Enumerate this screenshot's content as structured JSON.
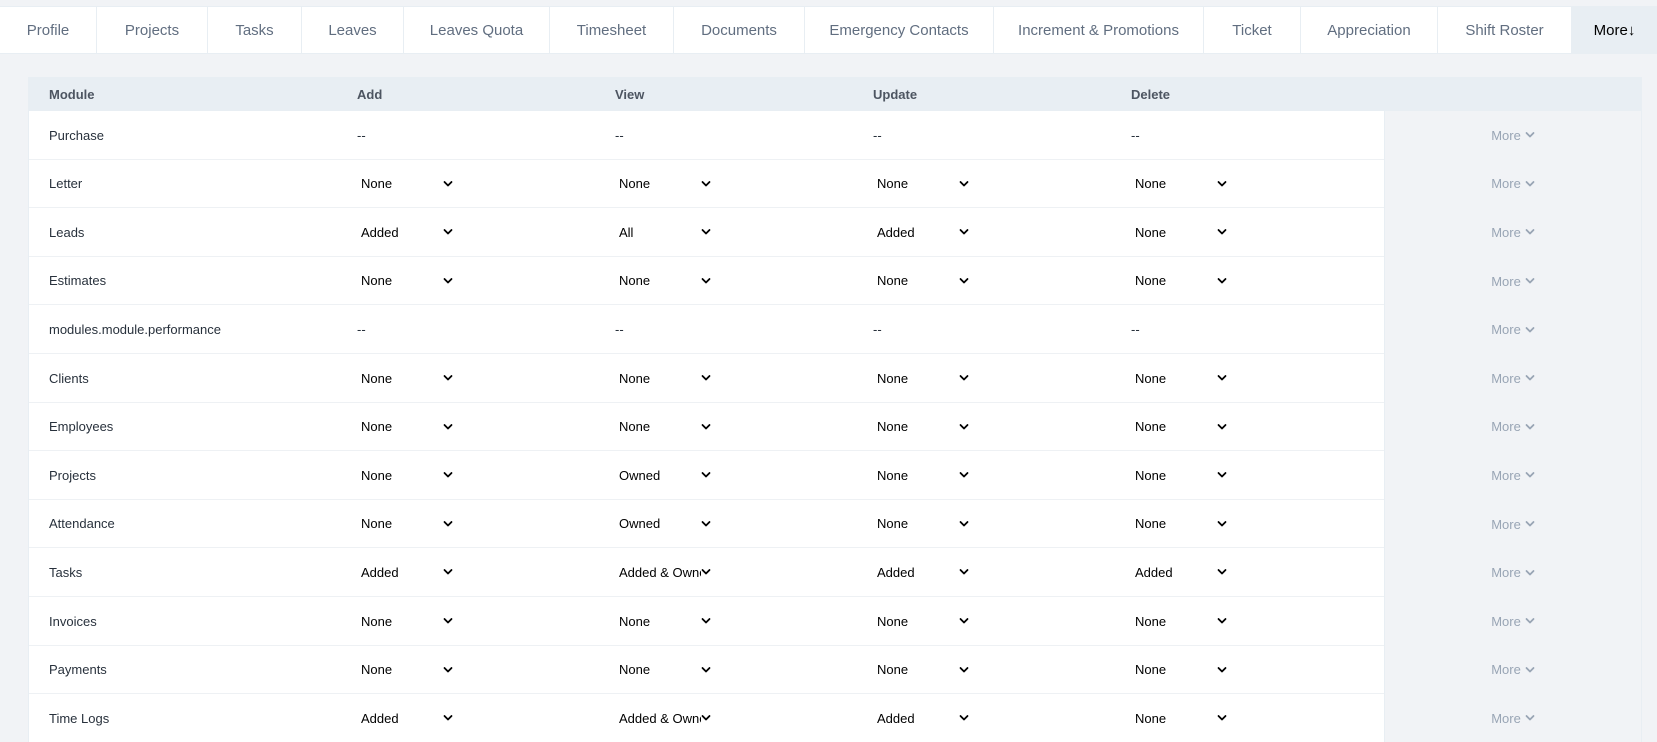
{
  "tabs": [
    {
      "label": "Profile",
      "w": 97
    },
    {
      "label": "Projects",
      "w": 111
    },
    {
      "label": "Tasks",
      "w": 94
    },
    {
      "label": "Leaves",
      "w": 102
    },
    {
      "label": "Leaves Quota",
      "w": 146
    },
    {
      "label": "Timesheet",
      "w": 124
    },
    {
      "label": "Documents",
      "w": 131
    },
    {
      "label": "Emergency Contacts",
      "w": 189
    },
    {
      "label": "Increment & Promotions",
      "w": 210
    },
    {
      "label": "Ticket",
      "w": 97
    },
    {
      "label": "Appreciation",
      "w": 137
    },
    {
      "label": "Shift Roster",
      "w": 134
    },
    {
      "label": "More",
      "w": 85,
      "more": true
    }
  ],
  "more_tab_arrow": "↓",
  "headers": {
    "module": "Module",
    "add": "Add",
    "view": "View",
    "update": "Update",
    "delete": "Delete"
  },
  "more_label": "More",
  "rows": [
    {
      "module": "Purchase",
      "add": "--",
      "view": "--",
      "update": "--",
      "delete": "--",
      "static": true
    },
    {
      "module": "Letter",
      "add": "None",
      "view": "None",
      "update": "None",
      "delete": "None"
    },
    {
      "module": "Leads",
      "add": "Added",
      "view": "All",
      "update": "Added",
      "delete": "None"
    },
    {
      "module": "Estimates",
      "add": "None",
      "view": "None",
      "update": "None",
      "delete": "None"
    },
    {
      "module": "modules.module.performance",
      "add": "--",
      "view": "--",
      "update": "--",
      "delete": "--",
      "static": true
    },
    {
      "module": "Clients",
      "add": "None",
      "view": "None",
      "update": "None",
      "delete": "None"
    },
    {
      "module": "Employees",
      "add": "None",
      "view": "None",
      "update": "None",
      "delete": "None"
    },
    {
      "module": "Projects",
      "add": "None",
      "view": "Owned",
      "update": "None",
      "delete": "None"
    },
    {
      "module": "Attendance",
      "add": "None",
      "view": "Owned",
      "update": "None",
      "delete": "None"
    },
    {
      "module": "Tasks",
      "add": "Added",
      "view": "Added & Owned",
      "update": "Added",
      "delete": "Added"
    },
    {
      "module": "Invoices",
      "add": "None",
      "view": "None",
      "update": "None",
      "delete": "None"
    },
    {
      "module": "Payments",
      "add": "None",
      "view": "None",
      "update": "None",
      "delete": "None"
    },
    {
      "module": "Time Logs",
      "add": "Added",
      "view": "Added & Owned",
      "update": "Added",
      "delete": "None"
    }
  ],
  "icons": {
    "select_chevron": "chevron-down-icon",
    "more_chevron": "chevron-down-icon"
  },
  "colors": {
    "tab_text": "#616e80",
    "more_text": "#99a5b5",
    "header_bg": "#e8eef3",
    "page_bg": "#f1f3f6"
  }
}
